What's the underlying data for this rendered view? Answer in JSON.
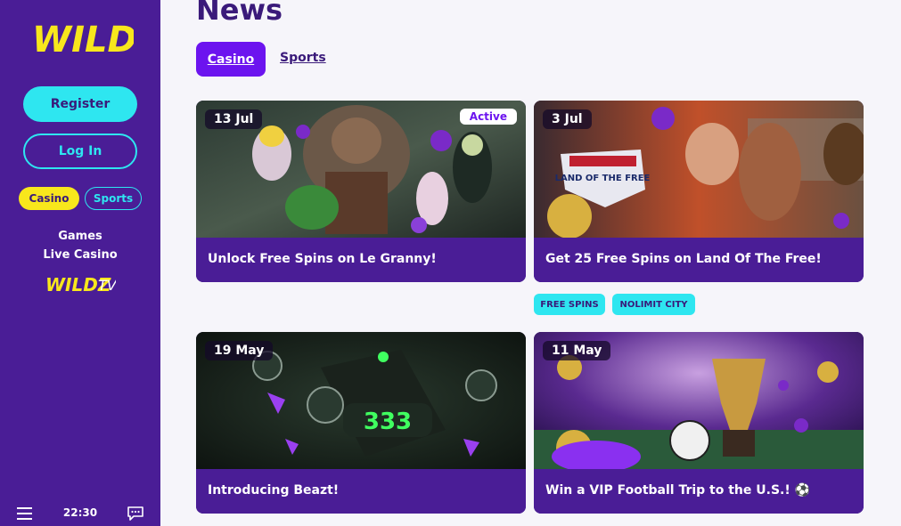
{
  "sidebar": {
    "register_label": "Register",
    "login_label": "Log In",
    "casino_label": "Casino",
    "sports_label": "Sports",
    "games_label": "Games",
    "live_casino_label": "Live Casino",
    "time": "22:30"
  },
  "main": {
    "title": "News",
    "tabs": [
      {
        "label": "Casino",
        "active": true
      },
      {
        "label": "Sports",
        "active": false
      }
    ],
    "cards": [
      {
        "date": "13 Jul",
        "title": "Unlock Free Spins on Le Granny!",
        "badge": "Active"
      },
      {
        "date": "3 Jul",
        "title": "Get 25 Free Spins on Land Of The Free!",
        "tags": [
          "FREE SPINS",
          "NOLIMIT CITY"
        ]
      },
      {
        "date": "19 May",
        "title": "Introducing Beazt!"
      },
      {
        "date": "11 May",
        "title": "Win a VIP Football Trip to the U.S.! ⚽"
      }
    ]
  },
  "colors": {
    "sidebar_bg": "#4a1d96",
    "accent_cyan": "#2ee6f0",
    "accent_yellow": "#f8e71c",
    "accent_purple": "#6c14ef",
    "title_color": "#3a1a7a"
  }
}
